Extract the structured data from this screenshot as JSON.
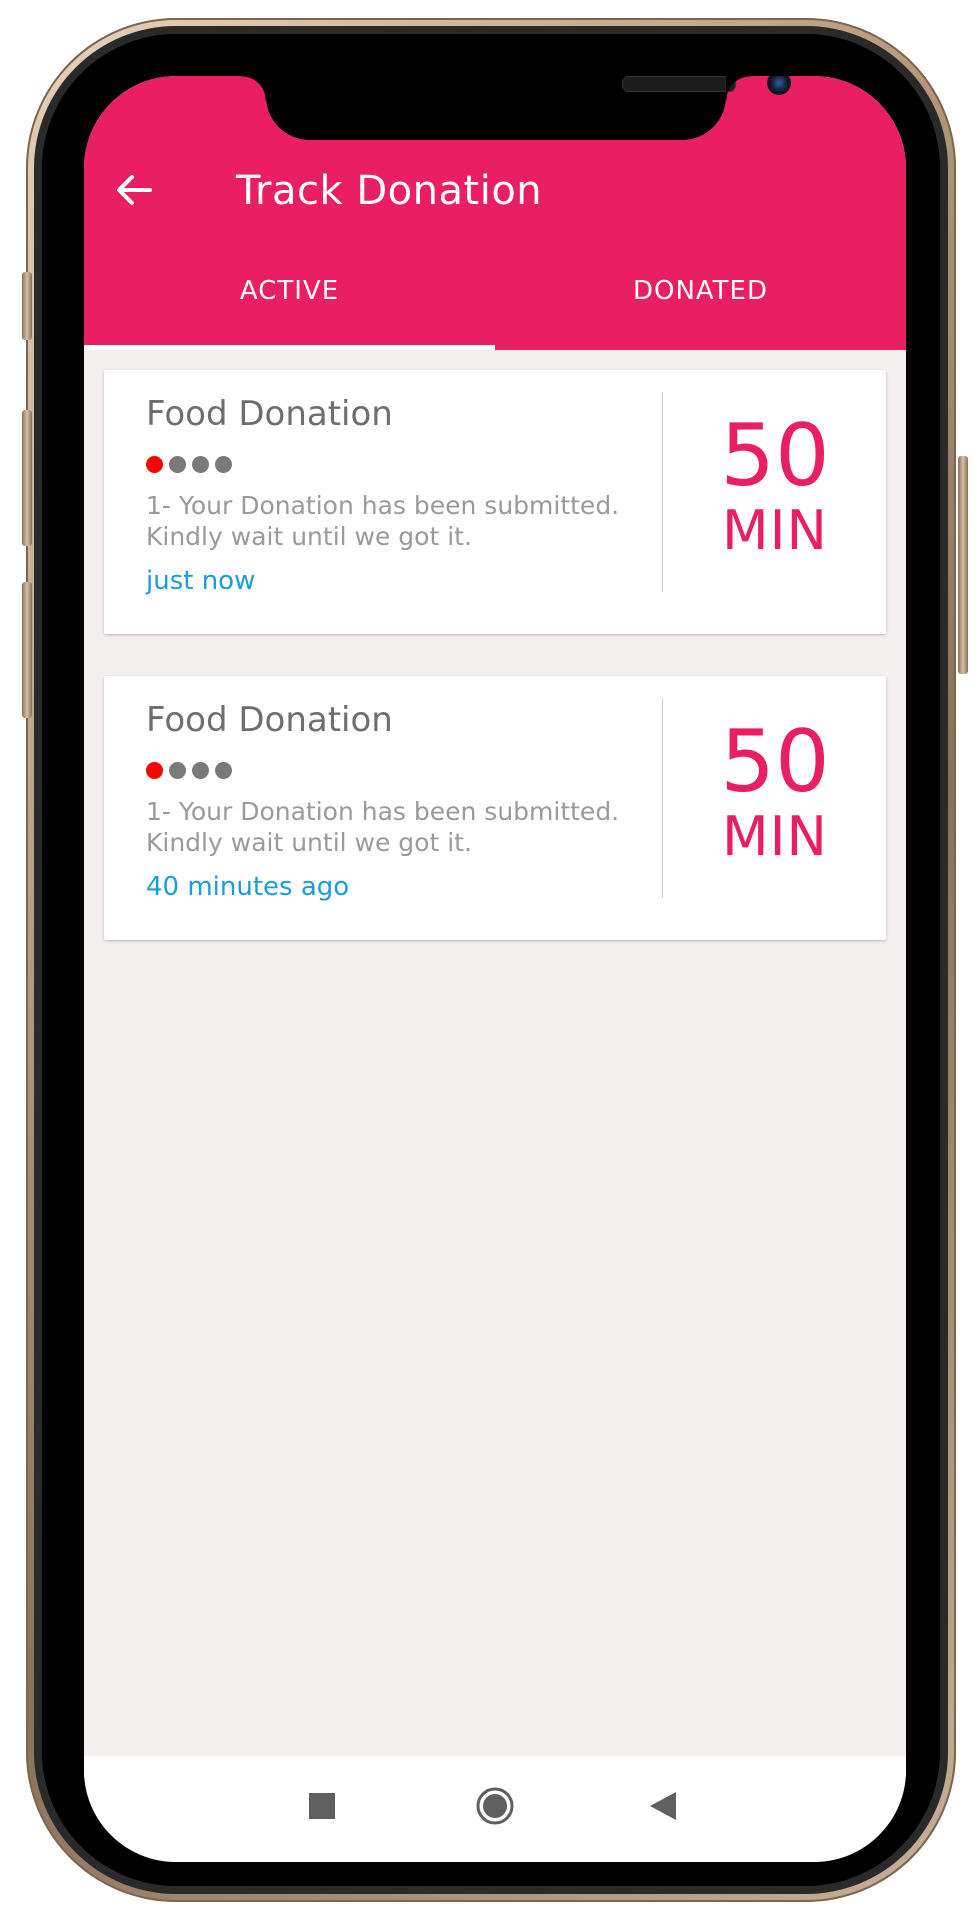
{
  "app": {
    "title": "Track Donation",
    "accent_color": "#e91e63",
    "back_icon": "arrow-left-icon"
  },
  "tabs": [
    {
      "label": "ACTIVE",
      "selected": true
    },
    {
      "label": "DONATED",
      "selected": false
    }
  ],
  "donations": [
    {
      "title": "Food Donation",
      "progress_step": 1,
      "progress_total": 4,
      "message": "1- Your Donation has been submitted. Kindly wait until we got it.",
      "time": "just now",
      "eta_value": "50",
      "eta_unit": "MIN"
    },
    {
      "title": "Food Donation",
      "progress_step": 1,
      "progress_total": 4,
      "message": "1- Your Donation has been submitted. Kindly wait until we got it.",
      "time": "40 minutes ago",
      "eta_value": "50",
      "eta_unit": "MIN"
    }
  ],
  "nav": {
    "recent_icon": "square-icon",
    "home_icon": "circle-icon",
    "back_icon": "triangle-back-icon"
  }
}
